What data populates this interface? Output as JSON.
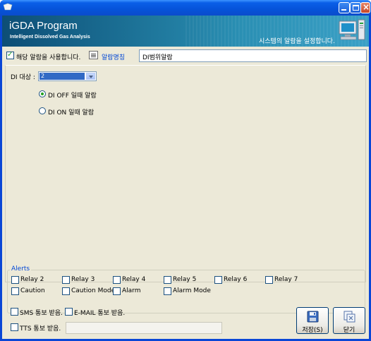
{
  "header": {
    "title": "iGDA Program",
    "subtitle": "Intelligent Dissolved Gas Analysis",
    "hint": "시스템의 알람을 설정합니다."
  },
  "enable": {
    "label": "해당 알람을 사용합니다.",
    "checked": true
  },
  "alarm_name": {
    "label": "알람명칭",
    "value": "DI범위알람"
  },
  "di_target": {
    "label": "DI 대상 :",
    "value": "2"
  },
  "radios": [
    {
      "label": "DI OFF 일때 알람",
      "selected": true
    },
    {
      "label": "DI ON 일때 알람",
      "selected": false
    }
  ],
  "alerts": {
    "title": "Alerts",
    "row1": [
      "Relay 2",
      "Relay 3",
      "Relay 4",
      "Relay 5",
      "Relay 6",
      "Relay 7"
    ],
    "row2": [
      "Caution",
      "Caution Mode",
      "Alarm",
      "Alarm Mode"
    ]
  },
  "notify": {
    "sms": "SMS 통보 받음.",
    "email": "E-MAIL 통보 받음.",
    "tts": "TTS 통보 받음."
  },
  "buttons": {
    "save": "저장(S)",
    "close": "닫기"
  },
  "colors": {
    "banner": "#1c7196",
    "titlebar": "#0a5fe8",
    "accent": "#0046d5"
  }
}
